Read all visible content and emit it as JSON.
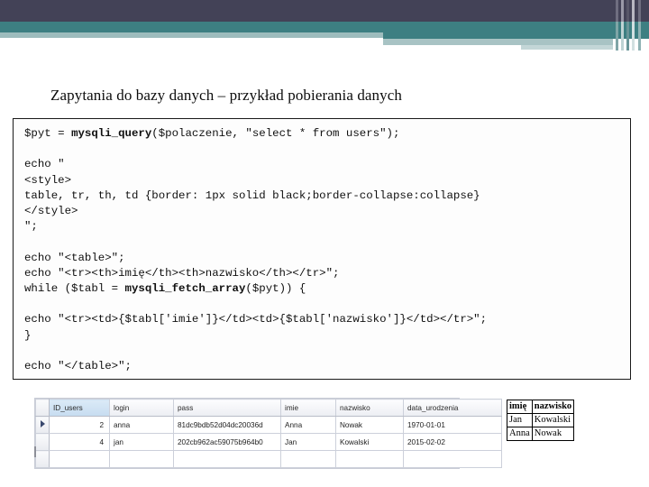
{
  "slide": {
    "title": "Zapytania do bazy danych – przykład pobierania danych"
  },
  "theme": {
    "navy": "#434257",
    "teal": "#3d7f82",
    "teal_light": "#9dbcbd",
    "pale": "#c3d6d7",
    "code_border": "#1a1a1a",
    "code_background": "#fdfdfd",
    "grid_selected_header": "#c6dcf0"
  },
  "code": {
    "language": "php",
    "lines": [
      {
        "segments": [
          {
            "text": "$pyt = ",
            "bold": false
          },
          {
            "text": "mysqli_query",
            "bold": true
          },
          {
            "text": "($polaczenie, \"select * from users\");",
            "bold": false
          }
        ]
      },
      {
        "segments": [
          {
            "text": "",
            "bold": false
          }
        ]
      },
      {
        "segments": [
          {
            "text": "echo \"",
            "bold": false
          }
        ]
      },
      {
        "segments": [
          {
            "text": "<style>",
            "bold": false
          }
        ]
      },
      {
        "segments": [
          {
            "text": "table, tr, th, td {border: 1px solid black;border-collapse:collapse}",
            "bold": false
          }
        ]
      },
      {
        "segments": [
          {
            "text": "</style>",
            "bold": false
          }
        ]
      },
      {
        "segments": [
          {
            "text": "\";",
            "bold": false
          }
        ]
      },
      {
        "segments": [
          {
            "text": "",
            "bold": false
          }
        ]
      },
      {
        "segments": [
          {
            "text": "echo \"<table>\";",
            "bold": false
          }
        ]
      },
      {
        "segments": [
          {
            "text": "echo \"<tr><th>imię</th><th>nazwisko</th></tr>\";",
            "bold": false
          }
        ]
      },
      {
        "segments": [
          {
            "text": "while ($tabl = ",
            "bold": false
          },
          {
            "text": "mysqli_fetch_array",
            "bold": true
          },
          {
            "text": "($pyt)) {",
            "bold": false
          }
        ]
      },
      {
        "segments": [
          {
            "text": "",
            "bold": false
          }
        ]
      },
      {
        "segments": [
          {
            "text": "echo \"<tr><td>{$tabl['imie']}</td><td>{$tabl['nazwisko']}</td></tr>\";",
            "bold": false
          }
        ]
      },
      {
        "segments": [
          {
            "text": "}",
            "bold": false
          }
        ]
      },
      {
        "segments": [
          {
            "text": "",
            "bold": false
          }
        ]
      },
      {
        "segments": [
          {
            "text": "echo \"</table>\";",
            "bold": false
          }
        ]
      }
    ]
  },
  "db_grid": {
    "row_marker": "▶",
    "selected_column": "ID_users",
    "columns": [
      "ID_users",
      "login",
      "pass",
      "imie",
      "nazwisko",
      "data_urodzenia"
    ],
    "rows": [
      {
        "ID_users": "2",
        "login": "anna",
        "pass": "81dc9bdb52d04dc20036d",
        "imie": "Anna",
        "nazwisko": "Nowak",
        "data_urodzenia": "1970-01-01",
        "marker": true
      },
      {
        "ID_users": "4",
        "login": "jan",
        "pass": "202cb962ac59075b964b0",
        "imie": "Jan",
        "nazwisko": "Kowalski",
        "data_urodzenia": "2015-02-02",
        "marker": false
      }
    ]
  },
  "output_table": {
    "headers": [
      "imię",
      "nazwisko"
    ],
    "rows": [
      [
        "Jan",
        "Kowalski"
      ],
      [
        "Anna",
        "Nowak"
      ]
    ]
  }
}
